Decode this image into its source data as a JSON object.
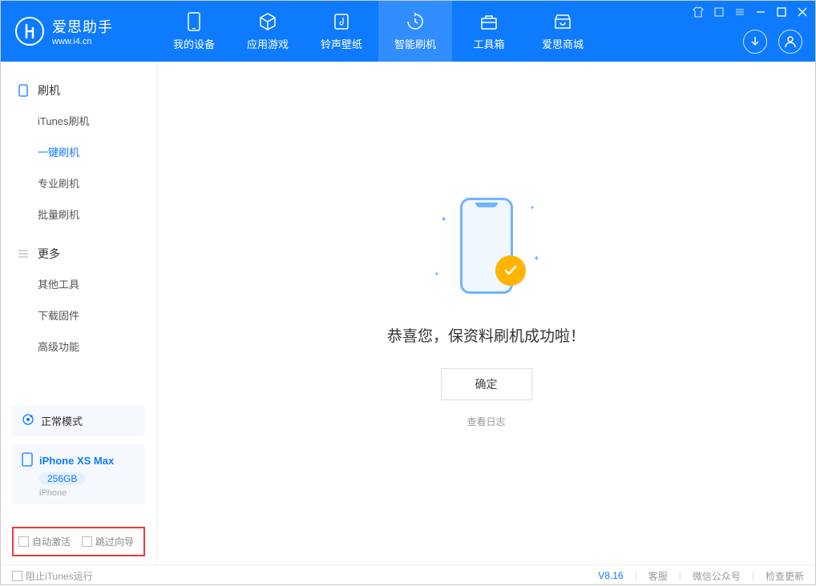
{
  "app": {
    "name": "爱思助手",
    "url": "www.i4.cn"
  },
  "nav": {
    "tabs": [
      {
        "label": "我的设备",
        "icon": "device"
      },
      {
        "label": "应用游戏",
        "icon": "cube"
      },
      {
        "label": "铃声壁纸",
        "icon": "music"
      },
      {
        "label": "智能刷机",
        "icon": "refresh"
      },
      {
        "label": "工具箱",
        "icon": "toolbox"
      },
      {
        "label": "爱思商城",
        "icon": "store"
      }
    ]
  },
  "sidebar": {
    "group1": {
      "title": "刷机"
    },
    "items1": [
      {
        "label": "iTunes刷机"
      },
      {
        "label": "一键刷机"
      },
      {
        "label": "专业刷机"
      },
      {
        "label": "批量刷机"
      }
    ],
    "group2": {
      "title": "更多"
    },
    "items2": [
      {
        "label": "其他工具"
      },
      {
        "label": "下载固件"
      },
      {
        "label": "高级功能"
      }
    ],
    "mode": "正常模式",
    "device": {
      "name": "iPhone XS Max",
      "storage": "256GB",
      "type": "iPhone"
    },
    "options": {
      "auto_activate": "自动激活",
      "skip_guide": "跳过向导"
    }
  },
  "main": {
    "success_msg": "恭喜您，保资料刷机成功啦！",
    "ok_btn": "确定",
    "log_link": "查看日志"
  },
  "footer": {
    "block_itunes": "阻止iTunes运行",
    "version": "V8.16",
    "links": {
      "support": "客服",
      "wechat": "微信公众号",
      "update": "检查更新"
    }
  }
}
